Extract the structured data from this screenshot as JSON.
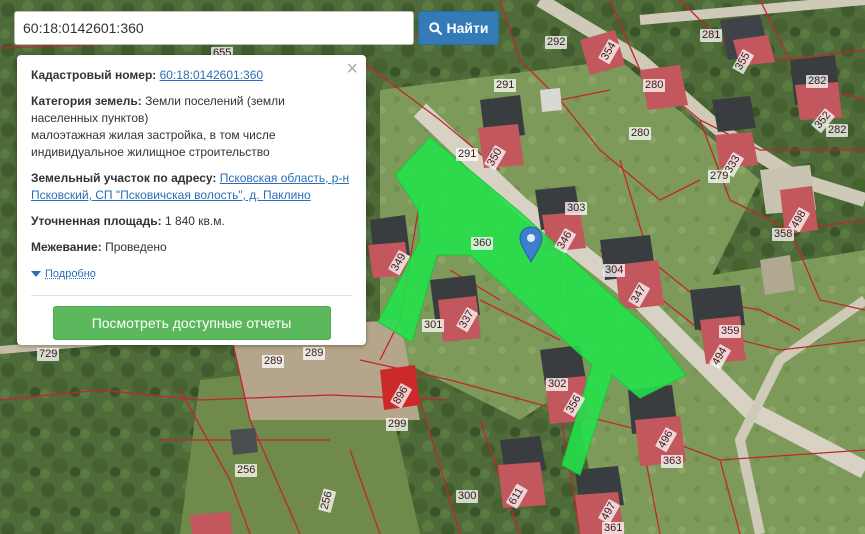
{
  "search": {
    "value": "60:18:0142601:360",
    "button_label": "Найти"
  },
  "info": {
    "cadastral_label": "Кадастровый номер:",
    "cadastral_value": "60:18:0142601:360",
    "category_label": "Категория земель:",
    "category_value": "Земли поселений (земли населенных пунктов)",
    "category_extra": "малоэтажная жилая застройка, в том числе индивидуальное жилищное строительство",
    "address_label": "Земельный участок по адресу:",
    "address_value": "Псковская область, р-н Псковский, СП \"Псковичская волость\", д. Паклино",
    "area_label": "Уточненная площадь:",
    "area_value": "1 840 кв.м.",
    "survey_label": "Межевание:",
    "survey_value": "Проведено",
    "details_label": "Подробно",
    "reports_button": "Посмотреть доступные отчеты"
  },
  "parcel_labels": [
    "655",
    "292",
    "354",
    "281",
    "355",
    "282",
    "291",
    "280",
    "352",
    "282",
    "291",
    "350",
    "280",
    "333",
    "279",
    "498",
    "303",
    "358",
    "346",
    "360",
    "304",
    "347",
    "359",
    "349",
    "494",
    "301",
    "337",
    "729",
    "289",
    "289",
    "302",
    "356",
    "896",
    "299",
    "496",
    "363",
    "256",
    "256",
    "300",
    "611",
    "497",
    "361"
  ],
  "colors": {
    "highlight": "#22e34a",
    "boundary": "#c0272d",
    "search_button": "#337ab7",
    "reports_button": "#5cb85c",
    "marker": "#3d7ecf"
  },
  "icons": {
    "search": "magnifier-icon",
    "marker": "map-pin-icon",
    "close": "close-icon",
    "expand": "triangle-down-icon"
  }
}
